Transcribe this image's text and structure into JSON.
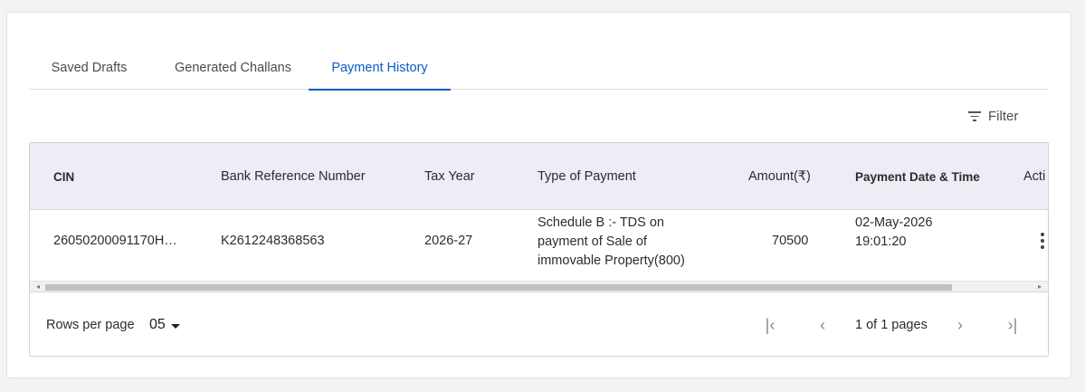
{
  "tabs": [
    {
      "label": "Saved Drafts",
      "active": false
    },
    {
      "label": "Generated Challans",
      "active": false
    },
    {
      "label": "Payment History",
      "active": true
    }
  ],
  "filter": {
    "label": "Filter",
    "icon": "filter-icon"
  },
  "table": {
    "columns": [
      "CIN",
      "Bank Reference Number",
      "Tax Year",
      "Type of Payment",
      "Amount(₹)",
      "Payment Date & Time",
      "Acti"
    ],
    "rows": [
      {
        "cin": "26050200091170H…",
        "bank_ref": "K2612248368563",
        "tax_year": "2026-27",
        "type_of_payment": "Schedule B :- TDS on payment of Sale of immovable Property(800)",
        "amount": "70500",
        "payment_date": "02-May-2026",
        "payment_time": "19:01:20",
        "action_icon": "kebab-menu-icon"
      }
    ]
  },
  "pagination": {
    "rows_per_page_label": "Rows per page",
    "rows_per_page_value": "05",
    "pages_text": "1 of 1 pages",
    "first_icon": "|‹",
    "prev_icon": "‹",
    "next_icon": "›",
    "last_icon": "›|"
  },
  "colors": {
    "accent": "#0b5cc7",
    "header_bg": "#ededf5"
  }
}
